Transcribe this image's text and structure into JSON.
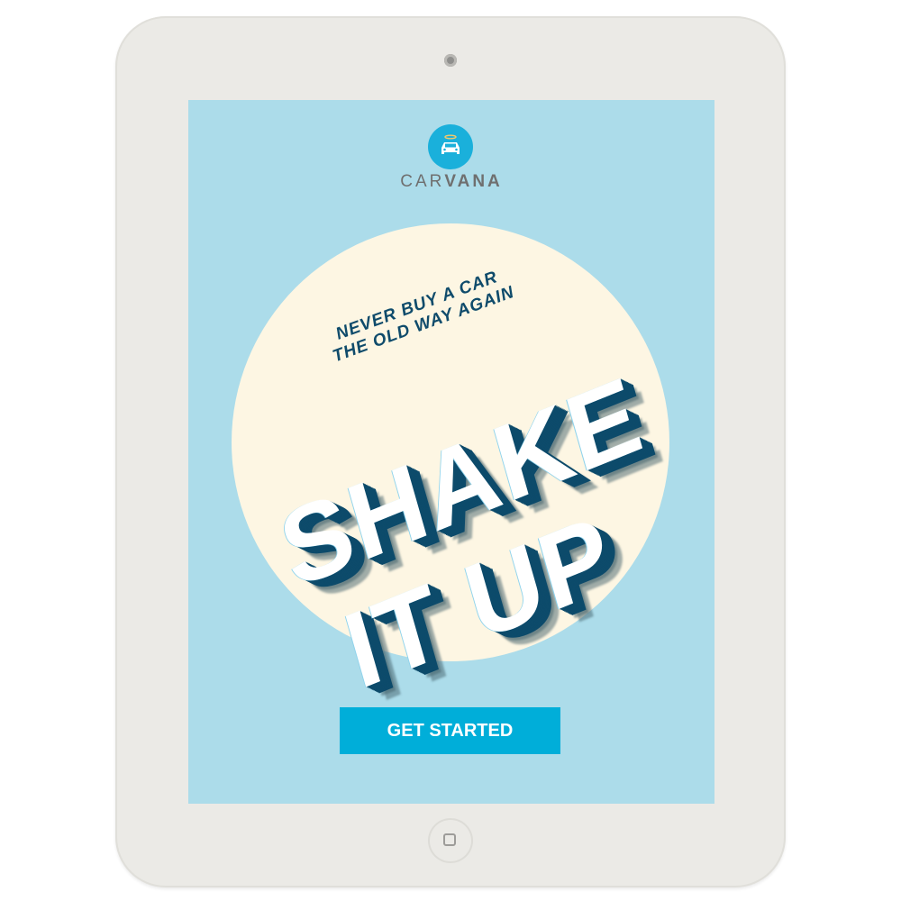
{
  "brand": {
    "name_light": "CAR",
    "name_bold": "VANA",
    "logo_icon": "car-with-halo-icon",
    "logo_color": "#1ab0db"
  },
  "hero": {
    "tagline_line1": "NEVER BUY A CAR",
    "tagline_line2": "THE OLD WAY AGAIN",
    "headline_line1": "SHAKE",
    "headline_line2": "IT UP"
  },
  "cta": {
    "label": "GET STARTED",
    "color": "#00aed9"
  },
  "colors": {
    "screen_bg": "#acdcea",
    "circle_bg": "#fdf6e3",
    "text_dark": "#0f4b6b",
    "device": "#ebeae6"
  }
}
